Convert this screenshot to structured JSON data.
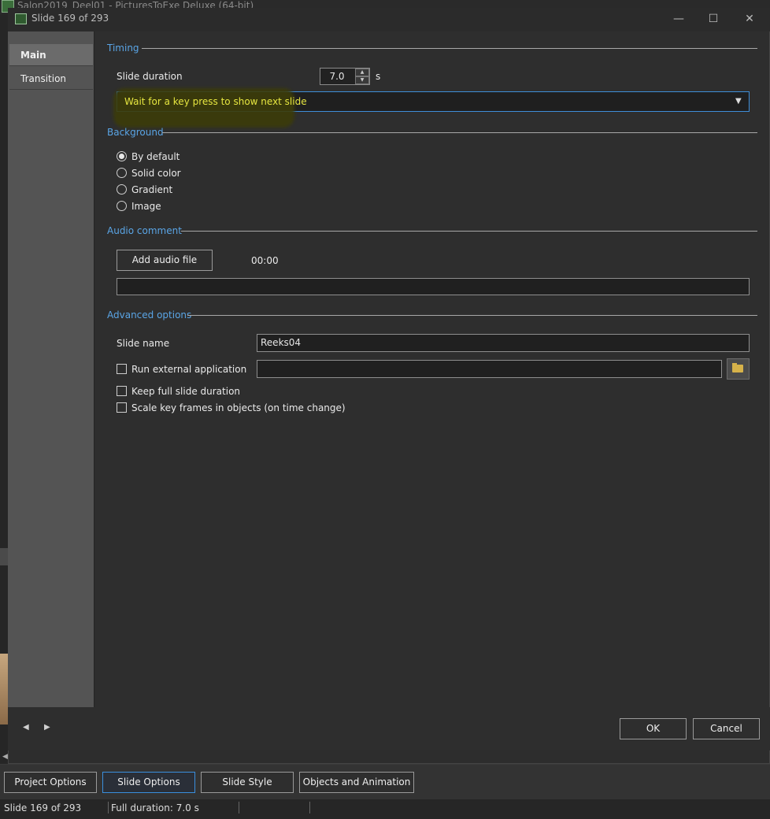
{
  "app": {
    "window_title": "Salon2019_Deel01 - PicturesToExe Deluxe (64-bit)"
  },
  "dialog": {
    "title": "Slide 169 of 293",
    "nav": [
      {
        "label": "Main"
      },
      {
        "label": "Transition"
      }
    ],
    "timing": {
      "section": "Timing",
      "duration_label": "Slide duration",
      "duration_value": "7.0",
      "duration_unit": "s",
      "mode_value": "Wait for a key press to show next slide"
    },
    "background": {
      "section": "Background",
      "options": [
        "By default",
        "Solid color",
        "Gradient",
        "Image"
      ],
      "selected": "By default"
    },
    "audio": {
      "section": "Audio comment",
      "add_button": "Add audio file",
      "time": "00:00",
      "file_value": ""
    },
    "advanced": {
      "section": "Advanced options",
      "slide_name_label": "Slide name",
      "slide_name_value": "Reeks04",
      "run_external_label": "Run external application",
      "run_external_value": "",
      "keep_full_label": "Keep full slide duration",
      "scale_keyframes_label": "Scale key frames in objects (on time change)"
    },
    "footer": {
      "ok": "OK",
      "cancel": "Cancel"
    }
  },
  "toolbar": {
    "buttons": [
      {
        "label": "Project Options"
      },
      {
        "label": "Slide Options"
      },
      {
        "label": "Slide Style"
      },
      {
        "label": "Objects and Animation"
      }
    ]
  },
  "statusbar": {
    "slide": "Slide 169 of 293",
    "duration": "Full duration: 7.0 s"
  }
}
